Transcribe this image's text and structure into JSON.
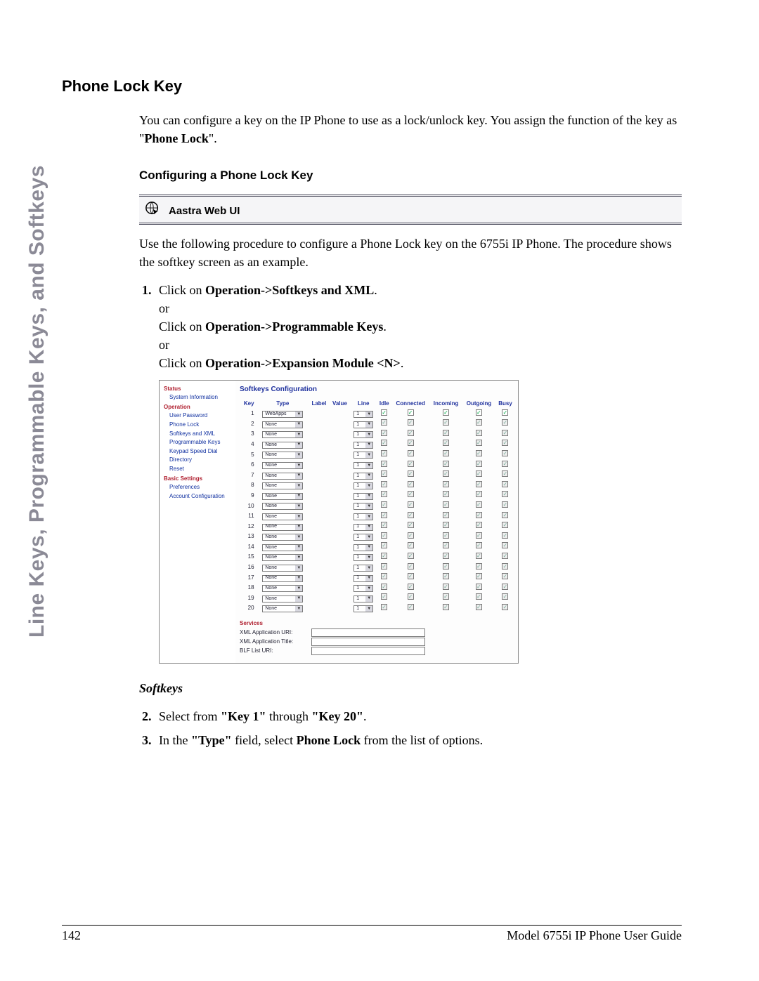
{
  "side_tab": "Line Keys, Programmable Keys, and Softkeys",
  "title": "Phone Lock Key",
  "intro": {
    "line1_pre": "You can configure a key on the IP Phone to use as a lock/unlock key. You assign the function of the key as \"",
    "line1_bold": "Phone Lock",
    "line1_post": "\"."
  },
  "subhead": "Configuring a Phone Lock Key",
  "banner": "Aastra Web UI",
  "after_banner": "Use the following procedure to configure a Phone Lock key on the 6755i IP Phone. The procedure shows the softkey screen as an example.",
  "step1": {
    "pre": "Click on ",
    "b1": "Operation->Softkeys and XML",
    "post1": ".",
    "or": "or",
    "pre2": "Click on ",
    "b2": "Operation->Programmable Keys",
    "post2": ".",
    "pre3": "Click on ",
    "b3": "Operation->Expansion Module <N>",
    "post3": "."
  },
  "shot": {
    "sidebar": {
      "groups": [
        {
          "label": "Status",
          "items": [
            "System Information"
          ]
        },
        {
          "label": "Operation",
          "items": [
            "User Password",
            "Phone Lock",
            "Softkeys and XML",
            "Programmable Keys",
            "Keypad Speed Dial",
            "Directory",
            "Reset"
          ]
        },
        {
          "label": "Basic Settings",
          "items": [
            "Preferences",
            "Account Configuration"
          ]
        }
      ]
    },
    "title": "Softkeys Configuration",
    "headers": [
      "Key",
      "Type",
      "Label",
      "Value",
      "Line",
      "Idle",
      "Connected",
      "Incoming",
      "Outgoing",
      "Busy"
    ],
    "first_type": "WebApps",
    "other_type": "None",
    "line_val": "1",
    "num_rows": 20,
    "services": {
      "title": "Services",
      "rows": [
        "XML Application URI:",
        "XML Application Title:",
        "BLF List URI:"
      ]
    }
  },
  "softkeys_head": "Softkeys",
  "step2": {
    "pre": "Select from ",
    "b1": "\"Key 1\"",
    "mid": " through ",
    "b2": "\"Key 20\"",
    "post": "."
  },
  "step3": {
    "pre": "In the ",
    "b1": "\"Type\"",
    "mid": " field, select ",
    "b2": "Phone Lock",
    "post": " from the list of options."
  },
  "footer": {
    "page": "142",
    "guide": "Model 6755i IP Phone User Guide"
  }
}
